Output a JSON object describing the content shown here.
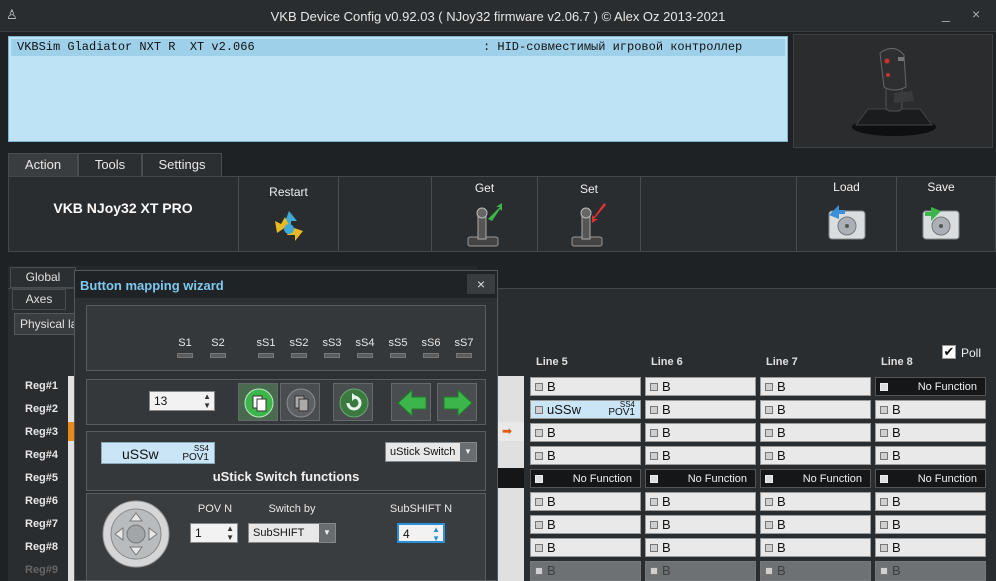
{
  "window": {
    "title": "VKB Device Config v0.92.03 ( NJoy32 firmware v2.06.7 ) © Alex Oz 2013-2021",
    "minimize": "_",
    "close": "×"
  },
  "device_line": {
    "name": "VKBSim Gladiator NXT R  XT v2.066",
    "desc": ": HID-совместимый игровой контроллер"
  },
  "main_tabs": [
    "Action",
    "Tools",
    "Settings"
  ],
  "toolbar": {
    "brand": "VKB NJoy32 XT PRO",
    "restart": "Restart",
    "get": "Get",
    "set": "Set",
    "load": "Load",
    "save": "Save"
  },
  "sub_tabs": {
    "global": "Global",
    "axes": "Axes",
    "physical": "Physical la"
  },
  "grid": {
    "poll_label": "Poll",
    "columns": [
      "Line 5",
      "Line 6",
      "Line 7",
      "Line 8"
    ],
    "rows": [
      "Reg#1",
      "Reg#2",
      "Reg#3",
      "Reg#4",
      "Reg#5",
      "Reg#6",
      "Reg#7",
      "Reg#8",
      "Reg#9"
    ],
    "cells": [
      [
        "B",
        "B",
        "B",
        "No Function"
      ],
      [
        "uSSw",
        "B",
        "B",
        "B"
      ],
      [
        "B",
        "B",
        "B",
        "B"
      ],
      [
        "B",
        "B",
        "B",
        "B"
      ],
      [
        "No Function",
        "No Function",
        "No Function",
        "No Function"
      ],
      [
        "B",
        "B",
        "B",
        "B"
      ],
      [
        "B",
        "B",
        "B",
        "B"
      ],
      [
        "B",
        "B",
        "B",
        "B"
      ],
      [
        "B",
        "B",
        "B",
        "B"
      ]
    ],
    "ussw_sub": {
      "ss": "SS4",
      "pov": "POV1"
    }
  },
  "wizard": {
    "title": "Button mapping wizard",
    "close": "×",
    "shift_labels": [
      "S1",
      "S2",
      "sS1",
      "sS2",
      "sS3",
      "sS4",
      "sS5",
      "sS6",
      "sS7"
    ],
    "button_number": "13",
    "function_preview": {
      "name": "uSSw",
      "ss": "SS4",
      "pov": "POV1"
    },
    "function_type": "uStick Switch",
    "section_title": "uStick Switch functions",
    "pov_label": "POV N",
    "pov_value": "1",
    "switch_label": "Switch by",
    "switch_value": "SubSHIFT",
    "subshift_label": "SubSHIFT N",
    "subshift_value": "4"
  },
  "colors": {
    "accent": "#7ec8ef",
    "info_bg": "#bde3f4",
    "go_green": "#3cb54a"
  }
}
